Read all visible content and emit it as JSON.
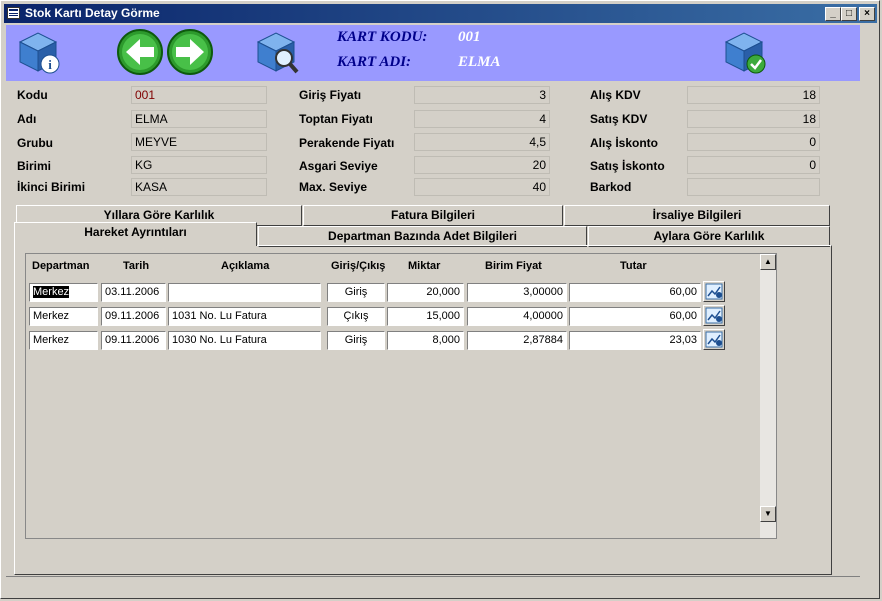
{
  "window": {
    "title": "Stok Kartı Detay Görme"
  },
  "header": {
    "kart_kodu_label": "KART KODU:",
    "kart_kodu_value": "001",
    "kart_adi_label": "KART ADI:",
    "kart_adi_value": "ELMA"
  },
  "toolbar": {
    "info_icon": "box-info-icon",
    "back_icon": "arrow-left-icon",
    "forward_icon": "arrow-right-icon",
    "search_icon": "box-search-icon",
    "ok_icon": "box-check-icon"
  },
  "fields": {
    "kodu": {
      "label": "Kodu",
      "value": "001"
    },
    "adi": {
      "label": "Adı",
      "value": "ELMA"
    },
    "grubu": {
      "label": "Grubu",
      "value": "MEYVE"
    },
    "birimi": {
      "label": "Birimi",
      "value": "KG"
    },
    "ikinci_birimi": {
      "label": "İkinci Birimi",
      "value": "KASA"
    },
    "giris_fiyati": {
      "label": "Giriş Fiyatı",
      "value": "3"
    },
    "toptan_fiyati": {
      "label": "Toptan Fiyatı",
      "value": "4"
    },
    "perakende_fiyati": {
      "label": "Perakende Fiyatı",
      "value": "4,5"
    },
    "asgari_seviye": {
      "label": "Asgari Seviye",
      "value": "20"
    },
    "max_seviye": {
      "label": "Max. Seviye",
      "value": "40"
    },
    "alis_kdv": {
      "label": "Alış KDV",
      "value": "18"
    },
    "satis_kdv": {
      "label": "Satış KDV",
      "value": "18"
    },
    "alis_iskonto": {
      "label": "Alış İskonto",
      "value": "0"
    },
    "satis_iskonto": {
      "label": "Satış İskonto",
      "value": "0"
    },
    "barkod": {
      "label": "Barkod",
      "value": ""
    }
  },
  "tabs": [
    {
      "label": "Yıllara Göre Karlılık"
    },
    {
      "label": "Fatura Bilgileri"
    },
    {
      "label": "İrsaliye Bilgileri"
    },
    {
      "label": "Hareket Ayrıntıları"
    },
    {
      "label": "Departman Bazında Adet Bilgileri"
    },
    {
      "label": "Aylara Göre Karlılık"
    }
  ],
  "table": {
    "columns": [
      "Departman",
      "Tarih",
      "Açıklama",
      "Giriş/Çıkış",
      "Miktar",
      "Birim Fiyat",
      "Tutar"
    ],
    "rows": [
      [
        "Merkez",
        "03.11.2006",
        "",
        "Giriş",
        "20,000",
        "3,00000",
        "60,00"
      ],
      [
        "Merkez",
        "09.11.2006",
        "1031 No. Lu Fatura",
        "Çıkış",
        "15,000",
        "4,00000",
        "60,00"
      ],
      [
        "Merkez",
        "09.11.2006",
        "1030 No. Lu Fatura",
        "Giriş",
        "8,000",
        "2,87884",
        "23,03"
      ]
    ],
    "row_button_icon": "chart-detail-icon"
  },
  "colors": {
    "toolbar_bg": "#9999ff",
    "title_start": "#0a246a",
    "header_label": "#00008b"
  }
}
